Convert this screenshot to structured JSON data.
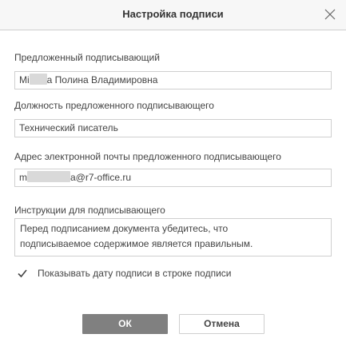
{
  "dialog": {
    "title": "Настройка подписи"
  },
  "signer": {
    "label": "Предложенный подписывающий",
    "value_prefix": "Mi",
    "value_suffix": "а Полина Владимировна"
  },
  "position": {
    "label": "Должность предложенного подписывающего",
    "value": "Технический писатель"
  },
  "email": {
    "label": "Адрес электронной почты предложенного подписывающего",
    "value_prefix": "m",
    "value_suffix": "a@r7-office.ru"
  },
  "instructions": {
    "label": "Инструкции для подписывающего",
    "line1": "Перед подписанием документа убедитесь, что",
    "line2": "подписываемое содержимое является правильным."
  },
  "show_date": {
    "label": "Показывать дату подписи в строке подписи",
    "checked": true
  },
  "buttons": {
    "ok": "ОК",
    "cancel": "Отмена"
  }
}
